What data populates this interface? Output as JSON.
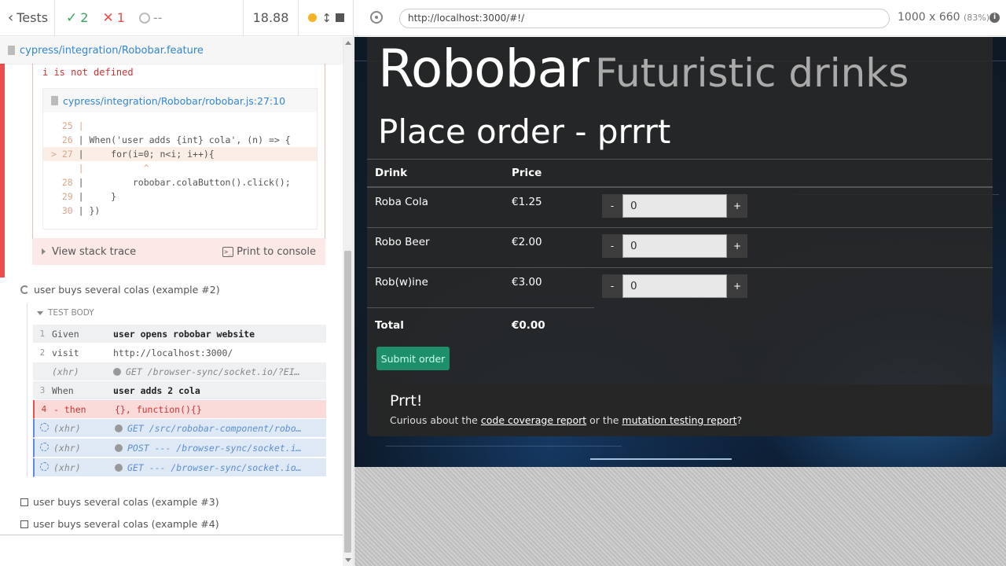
{
  "header": {
    "tests_label": "Tests",
    "passed": "2",
    "failed": "1",
    "pending": "--",
    "duration": "18.88"
  },
  "spec_file": "cypress/integration/Robobar.feature",
  "error": {
    "message": "i is not defined",
    "code_file": "cypress/integration/Robobar/robobar.js:27:10",
    "code_lines": [
      {
        "no": "  25 ",
        "text": "| "
      },
      {
        "no": "  26 ",
        "text": "| When('user adds {int} cola', (n) => {"
      },
      {
        "no": "> 27 ",
        "text": "|     for(i=0; n<i; i++){"
      },
      {
        "no": "     ",
        "text": "|           ^"
      },
      {
        "no": "  28 ",
        "text": "|         robobar.colaButton().click();"
      },
      {
        "no": "  29 ",
        "text": "|     }"
      },
      {
        "no": "  30 ",
        "text": "| })"
      }
    ],
    "view_stack": "View stack trace",
    "print_console": "Print to console"
  },
  "tests": [
    {
      "title": "user buys several colas (example #2)"
    },
    {
      "title": "user buys several colas (example #3)"
    },
    {
      "title": "user buys several colas (example #4)"
    }
  ],
  "test_body_label": "TEST BODY",
  "commands": [
    {
      "num": "1",
      "name": "Given",
      "msg": "user opens robobar website"
    },
    {
      "num": "2",
      "name": "visit",
      "msg": "http://localhost:3000/"
    },
    {
      "num": "",
      "name": "(xhr)",
      "msg": "GET /browser-sync/socket.io/?EI…"
    },
    {
      "num": "3",
      "name": "When",
      "msg": "user adds 2 cola"
    },
    {
      "num": "4",
      "name": "- then",
      "msg": "{}, function(){}"
    },
    {
      "num": "",
      "name": "(xhr)",
      "msg": "GET /src/robobar-component/robo…"
    },
    {
      "num": "",
      "name": "(xhr)",
      "msg": "POST --- /browser-sync/socket.i…"
    },
    {
      "num": "",
      "name": "(xhr)",
      "msg": "GET --- /browser-sync/socket.io…"
    }
  ],
  "aut": {
    "url": "http://localhost:3000/#!/",
    "viewport": "1000 x 660",
    "scale": "(83%)"
  },
  "app": {
    "brand": "Robobar",
    "tagline": "Futuristic drinks",
    "order_title": "Place order - prrrt",
    "col_drink": "Drink",
    "col_price": "Price",
    "drinks": [
      {
        "name": "Roba Cola",
        "price": "€1.25",
        "qty": "0"
      },
      {
        "name": "Robo Beer",
        "price": "€2.00",
        "qty": "0"
      },
      {
        "name": "Rob(w)ine",
        "price": "€3.00",
        "qty": "0"
      }
    ],
    "minus": "-",
    "plus": "+",
    "total_label": "Total",
    "total_value": "€0.00",
    "submit": "Submit order",
    "footer_title": "Prrt!",
    "footer_prefix": "Curious about the",
    "footer_link1": "code coverage report",
    "footer_mid": "or the",
    "footer_link2": "mutation testing report",
    "footer_suffix": "?"
  }
}
